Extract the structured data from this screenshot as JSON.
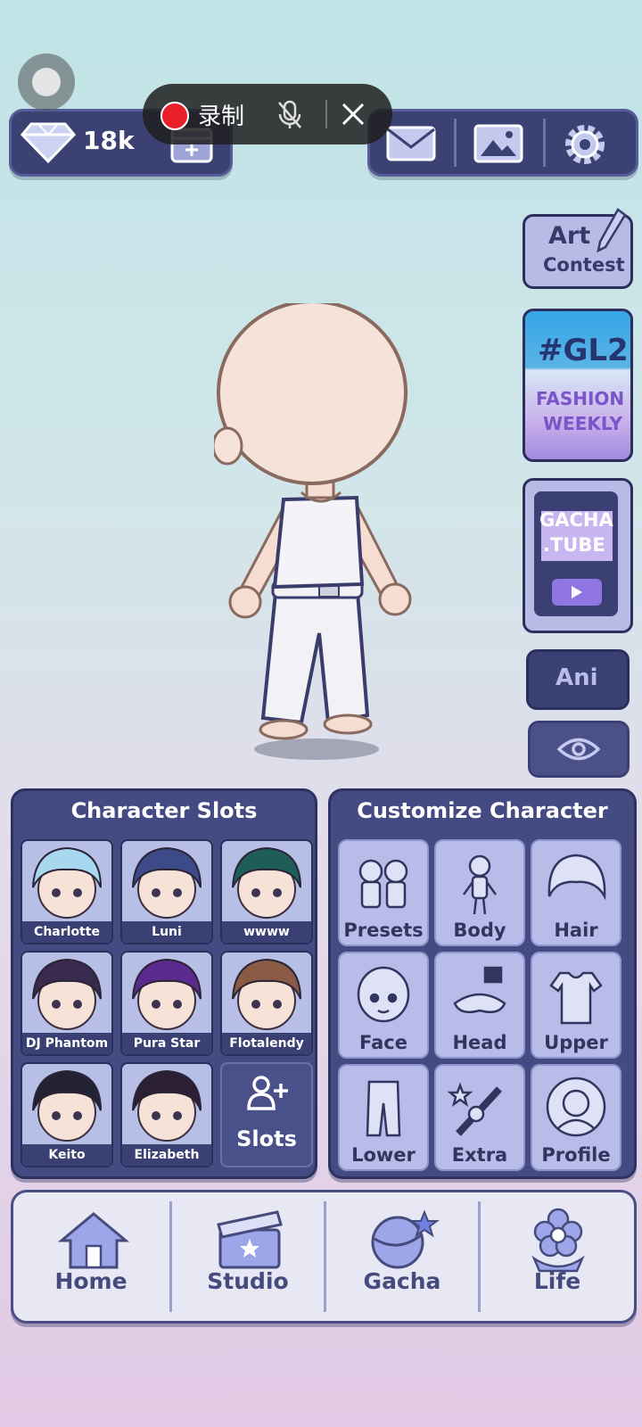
{
  "status": {
    "gems": "18k"
  },
  "recorder": {
    "label": "录制"
  },
  "side": {
    "art_contest_line1": "Art",
    "art_contest_line2": "Contest",
    "gl2_tag": "#GL2",
    "gl2_line1": "FASHION",
    "gl2_line2": "WEEKLY",
    "tube_line1": "GACHA",
    "tube_line2": ".TUBE",
    "ani_label": "Ani"
  },
  "slots_panel": {
    "title": "Character Slots",
    "slots": [
      {
        "name": "Charlotte",
        "hair": "#a8d8f0"
      },
      {
        "name": "Luni",
        "hair": "#3d4a8a"
      },
      {
        "name": "wwww",
        "hair": "#1f5e58"
      },
      {
        "name": "DJ Phantom",
        "hair": "#3a2a4e"
      },
      {
        "name": "Pura Star",
        "hair": "#5a2a8e"
      },
      {
        "name": "Flotalendy",
        "hair": "#8a5a44"
      },
      {
        "name": "Keito",
        "hair": "#222233"
      },
      {
        "name": "Elizabeth",
        "hair": "#2a1f33"
      }
    ],
    "add_slots_label": "Slots"
  },
  "customize_panel": {
    "title": "Customize Character",
    "items": [
      "Presets",
      "Body",
      "Hair",
      "Face",
      "Head",
      "Upper",
      "Lower",
      "Extra",
      "Profile"
    ]
  },
  "nav": {
    "items": [
      "Home",
      "Studio",
      "Gacha",
      "Life"
    ]
  }
}
